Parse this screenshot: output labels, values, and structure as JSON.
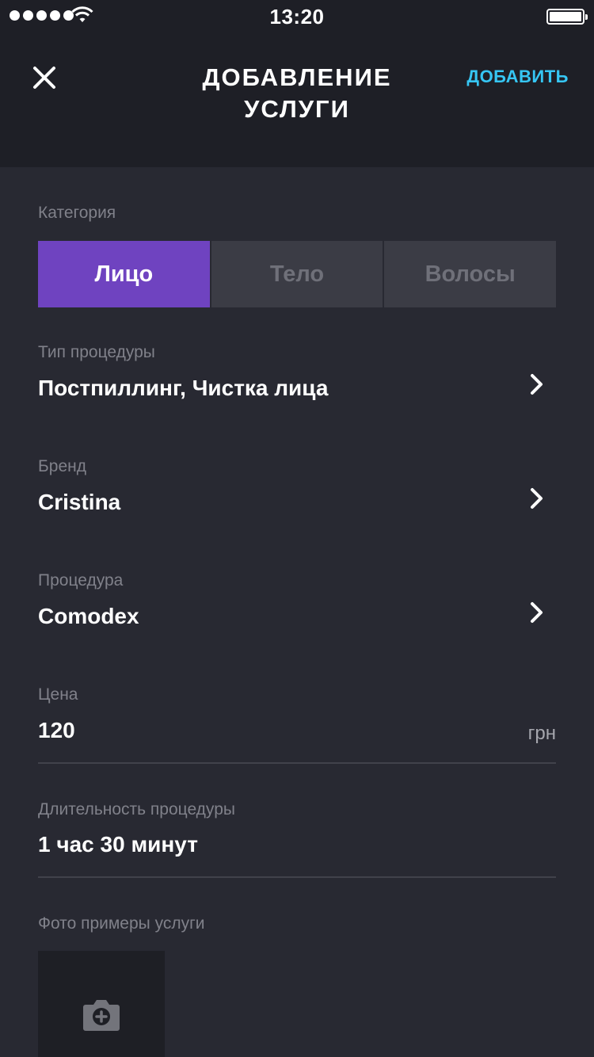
{
  "status_bar": {
    "time": "13:20",
    "signal_bars": 5,
    "icons": [
      "signal-dots-icon",
      "wifi-icon",
      "battery-icon"
    ]
  },
  "header": {
    "close_icon": "close-icon",
    "title_line1": "ДОБАВЛЕНИЕ",
    "title_line2": "УСЛУГИ",
    "action_label": "ДОБАВИТЬ"
  },
  "category": {
    "label": "Категория",
    "options": [
      "Лицо",
      "Тело",
      "Волосы"
    ],
    "selected": "Лицо"
  },
  "procedure_type": {
    "label": "Тип процедуры",
    "value": "Постпиллинг, Чистка лица",
    "icon": "chevron-right-icon"
  },
  "brand": {
    "label": "Бренд",
    "value": "Cristina",
    "icon": "chevron-right-icon"
  },
  "procedure": {
    "label": "Процедура",
    "value": "Comodex",
    "icon": "chevron-right-icon"
  },
  "price": {
    "label": "Цена",
    "value": "120",
    "unit": "грн"
  },
  "duration": {
    "label": "Длительность процедуры",
    "value": "1 час 30 минут"
  },
  "photos": {
    "label": "Фото примеры услуги",
    "add_icon": "camera-add-icon"
  },
  "colors": {
    "header_bg": "#1e1f26",
    "body_bg": "#282932",
    "accent_purple": "#6f43c0",
    "accent_cyan": "#36c6f4",
    "label_gray": "#80818a"
  }
}
